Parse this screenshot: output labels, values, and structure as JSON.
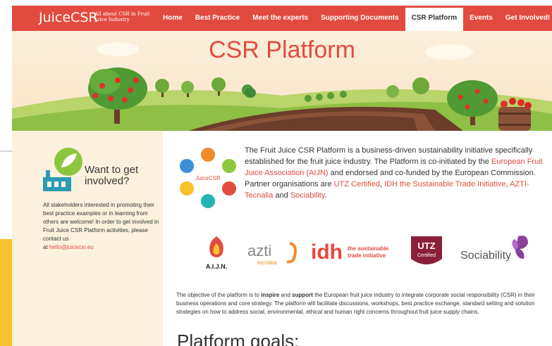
{
  "nav": {
    "logo": "JuiceCSR",
    "logo_sub": "All about CSR in Fruit Juice Industry",
    "items": [
      {
        "label": "Home"
      },
      {
        "label": "Best Practice"
      },
      {
        "label": "Meet the experts"
      },
      {
        "label": "Supporting Documents"
      },
      {
        "label": "CSR Platform",
        "active": true
      },
      {
        "label": "Events"
      },
      {
        "label": "Get Involved!"
      }
    ]
  },
  "hero": {
    "title": "CSR Platform"
  },
  "sidebar": {
    "title_line1": "Want to get",
    "title_line2": "involved?",
    "text": "All stakeholders interested in promoting their best practice examples or in learning from others are welcome! In order to get involved in Fruit Juice CSR Platform activities, please contact us",
    "text_at": "at",
    "email": "hello@juicecsr.eu"
  },
  "intro": {
    "p1": "The Fruit Juice CSR Platform is a business-driven sustainability initiative specifically established for the fruit juice industry. The Platform is co-initiated by the",
    "aijn_link": "European Fruit Juice Association (AIJN)",
    "p2": "and endorsed and co-funded by the European Commission. Partner organisations are",
    "utz_link": "UTZ Certified",
    "comma1": ",",
    "idh_link": "IDH the Sustainable Trade Initiative",
    "comma2": ",",
    "azti_link": "AZTI-Tecnalia",
    "and": "and",
    "soc_link": "Sociability",
    "end": "."
  },
  "circle_logo": {
    "label": "JuiceCSR"
  },
  "partners": {
    "aijn": "A.I.J.N.",
    "azti": "azti",
    "azti_sub": "tecnalia",
    "idh": "idh",
    "idh_sub1": "the sustainable",
    "idh_sub2": "trade initiative",
    "utz": "UTZ",
    "utz_sub": "Certified",
    "sociability": "Sociability"
  },
  "objective": {
    "a": "The objective of the platform is to",
    "inspire": "inspire",
    "b": "and",
    "support": "support",
    "c": "the European fruit juice industry to integrate corporate social responsibility (CSR) in their business operations and core strategy. The platform will facilitate discussions, workshops, best practice exchange, standard setting and solution strategies on how to address social, environmental, ethical and human right concerns throughout fruit juice supply chains."
  },
  "goals": {
    "title": "Platform goals:"
  },
  "colors": {
    "brand": "#e34a3f",
    "sidebar_bg": "#fbf1dd",
    "accent_yellow": "#f6c12c"
  }
}
